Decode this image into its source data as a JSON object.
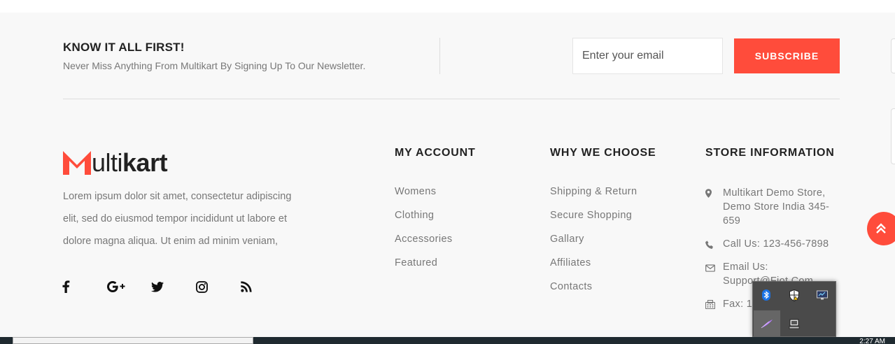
{
  "newsletter": {
    "title": "KNOW IT ALL FIRST!",
    "subtitle": "Never Miss Anything From Multikart By Signing Up To Our Newsletter.",
    "email_placeholder": "Enter your email",
    "subscribe_label": "SUBSCRIBE"
  },
  "brand": {
    "logo_text_light": "ulti",
    "logo_text_bold": "kart",
    "accent_color": "#ff4c3b",
    "about_lines": [
      "Lorem ipsum dolor sit amet, consectetur adipiscing",
      "elit, sed do eiusmod tempor incididunt ut labore et",
      "dolore magna aliqua. Ut enim ad minim veniam,"
    ]
  },
  "socials": [
    "facebook-icon",
    "google-plus-icon",
    "twitter-icon",
    "instagram-icon",
    "rss-icon"
  ],
  "my_account": {
    "title": "MY ACCOUNT",
    "links": [
      "Womens",
      "Clothing",
      "Accessories",
      "Featured"
    ]
  },
  "why_we_choose": {
    "title": "WHY WE CHOOSE",
    "links": [
      "Shipping & Return",
      "Secure Shopping",
      "Gallary",
      "Affiliates",
      "Contacts"
    ]
  },
  "store_information": {
    "title": "STORE INFORMATION",
    "address": "Multikart Demo Store, Demo Store India 345-659",
    "call": "Call Us: 123-456-7898",
    "email_label": "Email Us:",
    "email_value": "Support@Fiot.Com",
    "fax": "Fax: 123456"
  },
  "taskbar": {
    "clock": "2:27 AM"
  }
}
